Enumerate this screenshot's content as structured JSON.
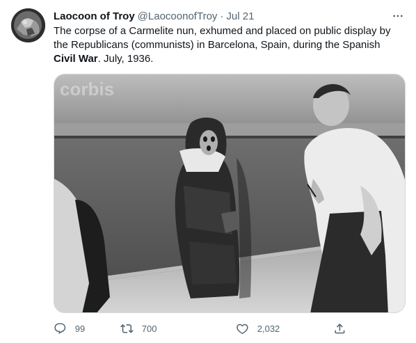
{
  "author": {
    "display_name": "Laocoon of Troy",
    "handle": "@LaocoonofTroy",
    "separator": "·",
    "date": "Jul 21",
    "avatar_icon": "avatar-image"
  },
  "tweet": {
    "text_before_bold": "The corpse of a Carmelite nun, exhumed and placed on public display by the Republicans (communists) in Barcelona, Spain, during the Spanish ",
    "text_bold": "Civil War",
    "text_after_bold": ". July, 1936.",
    "watermark": "corbis"
  },
  "actions": {
    "reply_count": "99",
    "retweet_count": "700",
    "like_count": "2,032",
    "reply_icon": "reply-icon",
    "retweet_icon": "retweet-icon",
    "like_icon": "heart-icon",
    "share_icon": "share-icon",
    "more_icon": "more-icon"
  },
  "colors": {
    "primary_text": "#0f1419",
    "secondary_text": "#536471",
    "border": "#cfd9de"
  }
}
